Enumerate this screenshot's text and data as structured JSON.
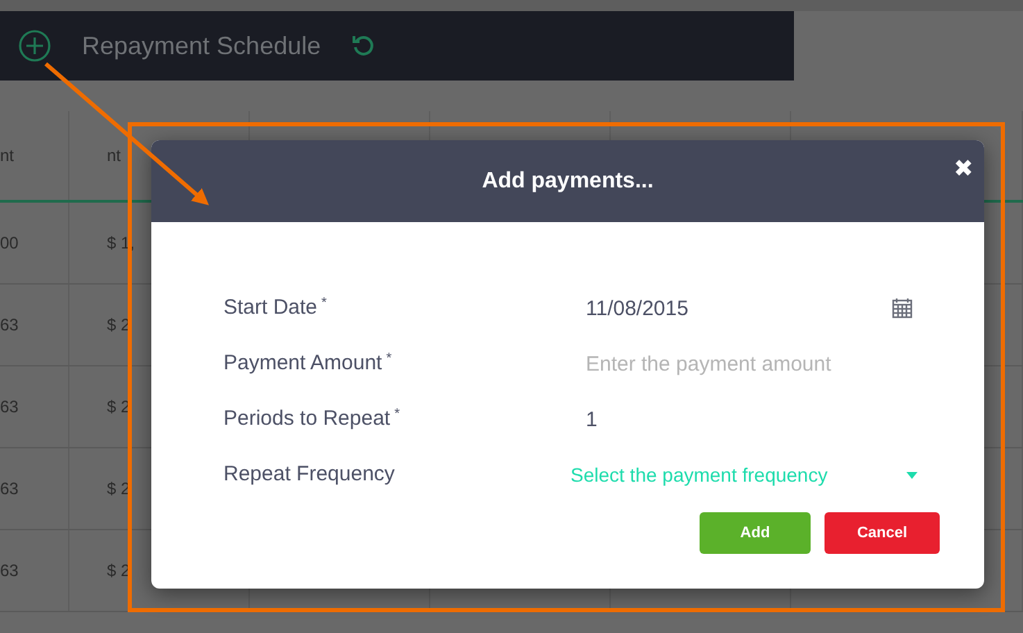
{
  "header": {
    "title": "Repayment Schedule"
  },
  "table": {
    "columns": [
      "nt",
      "nt"
    ],
    "rows": [
      [
        "00",
        "$ 1,"
      ],
      [
        "63",
        "$ 2"
      ],
      [
        "63",
        "$ 2"
      ],
      [
        "63",
        "$ 2"
      ],
      [
        "63",
        "$ 2"
      ]
    ]
  },
  "dialog": {
    "title": "Add payments...",
    "close": "✖",
    "fields": [
      {
        "kind": "date",
        "label": "Start Date",
        "mark": "*",
        "value": "11/08/2015"
      },
      {
        "kind": "text",
        "label": "Payment Amount",
        "mark": "*",
        "placeholder": "Enter the payment amount"
      },
      {
        "kind": "number",
        "label": "Periods to Repeat",
        "mark": "*",
        "value": "1"
      },
      {
        "kind": "select",
        "label": "Repeat Frequency",
        "placeholder": "Select the payment frequency"
      }
    ],
    "buttons": [
      {
        "kind": "confirm",
        "label": "Add"
      },
      {
        "kind": "cancel",
        "label": "Cancel"
      }
    ]
  }
}
